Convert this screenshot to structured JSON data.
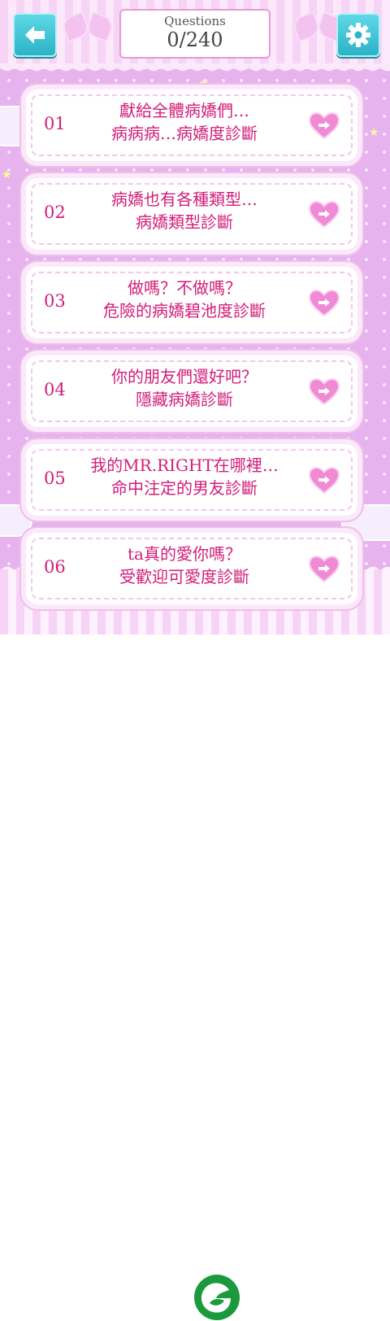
{
  "header": {
    "counter_label": "Questions",
    "counter_value": "0/240"
  },
  "quizzes": [
    {
      "number": "01",
      "line1": "獻給全體病嬌們…",
      "line2": "病病病…病嬌度診斷"
    },
    {
      "number": "02",
      "line1": "病嬌也有各種類型…",
      "line2": "病嬌類型診斷"
    },
    {
      "number": "03",
      "line1": "做嗎？不做嗎？",
      "line2": "危險的病嬌碧池度診斷"
    },
    {
      "number": "04",
      "line1": "你的朋友們還好吧？",
      "line2": "隱藏病嬌診斷"
    },
    {
      "number": "05",
      "line1": "我的MR.RIGHT在哪裡…",
      "line2": "命中注定的男友診斷"
    },
    {
      "number": "06",
      "line1": "ta真的愛你嗎？",
      "line2": "受歡迎可愛度診斷"
    }
  ],
  "colors": {
    "accent_text": "#d21d78",
    "button_teal": "#2bb3c7",
    "background_pink": "#e6b3ee",
    "heart_pink": "#f08ad4",
    "logo_green": "#1a9a3c"
  },
  "icons": {
    "back": "arrow-left-icon",
    "settings": "gear-icon",
    "go": "heart-arrow-icon",
    "logo": "leaf-g-logo"
  }
}
